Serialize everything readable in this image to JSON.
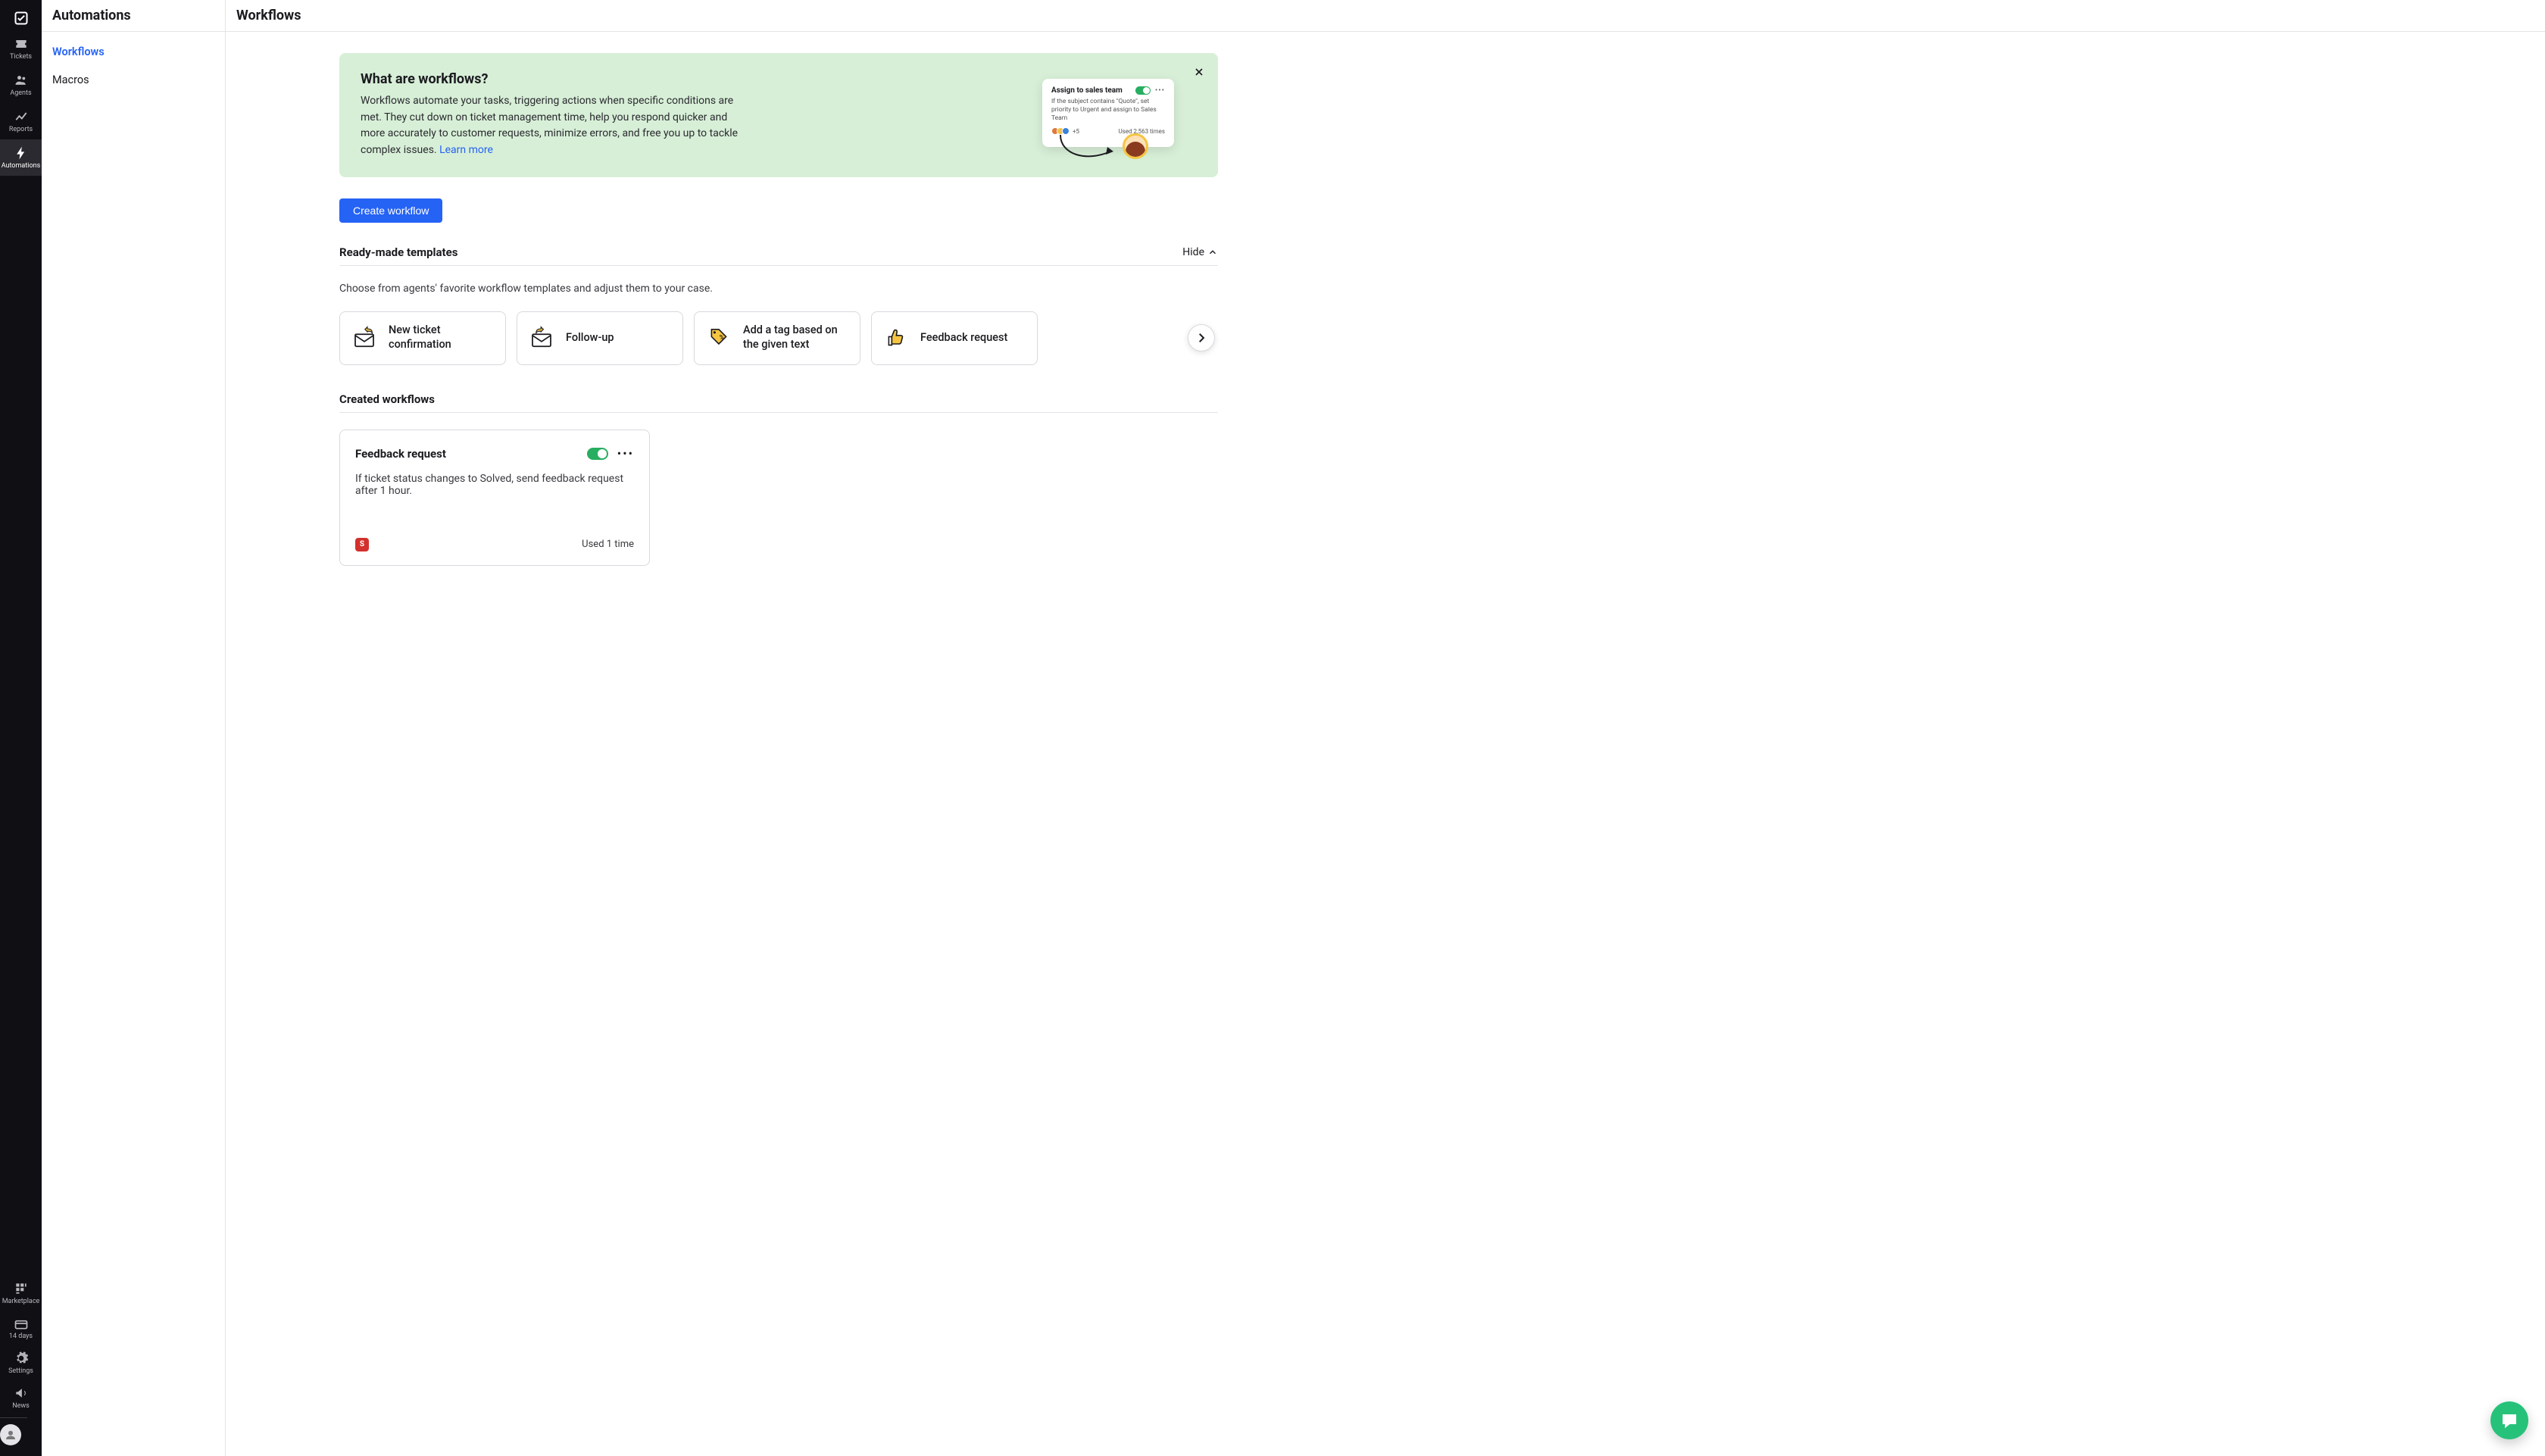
{
  "rail": {
    "items": [
      {
        "label": "Tickets"
      },
      {
        "label": "Agents"
      },
      {
        "label": "Reports"
      },
      {
        "label": "Automations"
      }
    ],
    "bottom": [
      {
        "label": "Marketplace"
      },
      {
        "label": "14 days"
      },
      {
        "label": "Settings"
      },
      {
        "label": "News"
      }
    ]
  },
  "subnav": {
    "title": "Automations",
    "items": [
      "Workflows",
      "Macros"
    ]
  },
  "main": {
    "title": "Workflows"
  },
  "banner": {
    "title": "What are workflows?",
    "body": "Workflows automate your tasks, triggering actions when specific conditions are met. They cut down on ticket management time, help you respond quicker and more accurately to customer requests, minimize errors, and free you up to tackle complex issues. ",
    "learnMore": "Learn more",
    "illus": {
      "title": "Assign to sales team",
      "desc": "If the subject contains \"Quote\", set priority to Urgent and assign to Sales Team",
      "plus": "+5",
      "used": "Used 2,563 times"
    }
  },
  "createBtn": "Create workflow",
  "templatesSection": {
    "title": "Ready-made templates",
    "hideLabel": "Hide",
    "desc": "Choose from agents' favorite workflow templates and adjust them to your case.",
    "cards": [
      "New ticket confirmation",
      "Follow-up",
      "Add a tag based on the given text",
      "Feedback request"
    ]
  },
  "createdSection": {
    "title": "Created workflows"
  },
  "workflow": {
    "title": "Feedback request",
    "desc": "If ticket status changes to Solved, send feedback request after 1 hour.",
    "badge": "S",
    "used": "Used 1 time"
  }
}
